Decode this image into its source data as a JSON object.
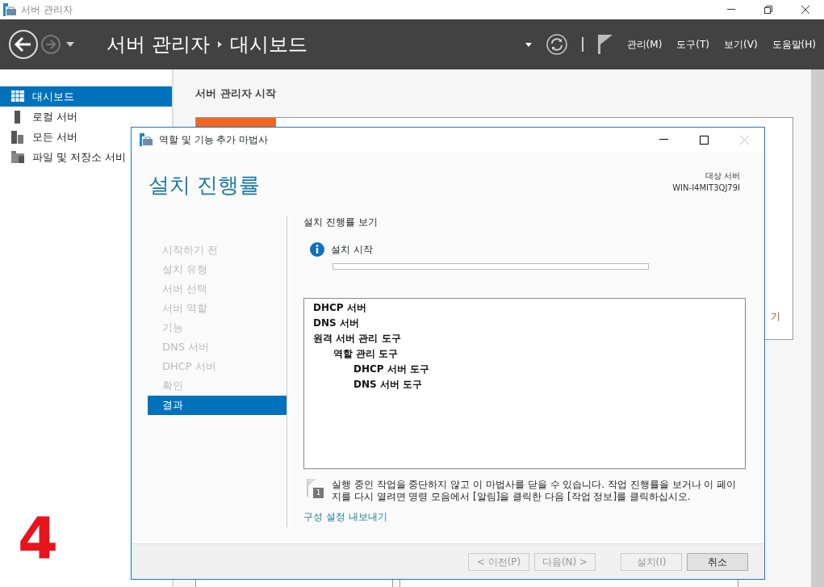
{
  "window": {
    "title": "서버 관리자"
  },
  "header": {
    "breadcrumb": [
      "서버 관리자",
      "대시보드"
    ],
    "menus": [
      "관리(M)",
      "도구(T)",
      "보기(V)",
      "도움말(H)"
    ]
  },
  "sidebar": {
    "items": [
      {
        "label": "대시보드",
        "selected": true
      },
      {
        "label": "로컬 서버",
        "selected": false
      },
      {
        "label": "모든 서버",
        "selected": false
      },
      {
        "label": "파일 및 저장소 서비",
        "selected": false
      }
    ]
  },
  "main": {
    "heading": "서버 관리자 시작",
    "partial_link": "기"
  },
  "annotation": "4",
  "wizard": {
    "title": "역할 및 기능 추가 마법사",
    "heading": "설치 진행률",
    "target_label": "대상 서버",
    "target_name": "WIN-I4MIT3QJ79I",
    "steps": [
      {
        "label": "시작하기 전",
        "selected": false
      },
      {
        "label": "설치 유형",
        "selected": false
      },
      {
        "label": "서버 선택",
        "selected": false
      },
      {
        "label": "서버 역할",
        "selected": false
      },
      {
        "label": "기능",
        "selected": false
      },
      {
        "label": "DNS 서버",
        "selected": false
      },
      {
        "label": "DHCP 서버",
        "selected": false
      },
      {
        "label": "확인",
        "selected": false
      },
      {
        "label": "결과",
        "selected": true
      }
    ],
    "section_title": "설치 진행률 보기",
    "status": "설치 시작",
    "progress": {
      "level": 0
    },
    "features": [
      {
        "label": "DHCP 서버"
      },
      {
        "label": "DNS 서버"
      },
      {
        "label": "원격 서버 관리 도구",
        "children": [
          {
            "label": "역할 관리 도구",
            "children": [
              {
                "label": "DHCP 서버 도구"
              },
              {
                "label": "DNS 서버 도구"
              }
            ]
          }
        ]
      }
    ],
    "note": "실행 중인 작업을 중단하지 않고 이 마법사를 닫을 수 있습니다. 작업 진행률을 보거나 이 페이지를 다시 열려면 명령 모음에서 [알림]을 클릭한 다음 [작업 정보]를 클릭하십시오.",
    "note_badge": "1",
    "export_link": "구성 설정 내보내기",
    "buttons": [
      {
        "label": "< 이전(P)",
        "disabled": true
      },
      {
        "label": "다음(N) >",
        "disabled": true
      },
      {
        "label": "설치(I)",
        "disabled": true
      },
      {
        "label": "취소",
        "disabled": false
      }
    ]
  }
}
